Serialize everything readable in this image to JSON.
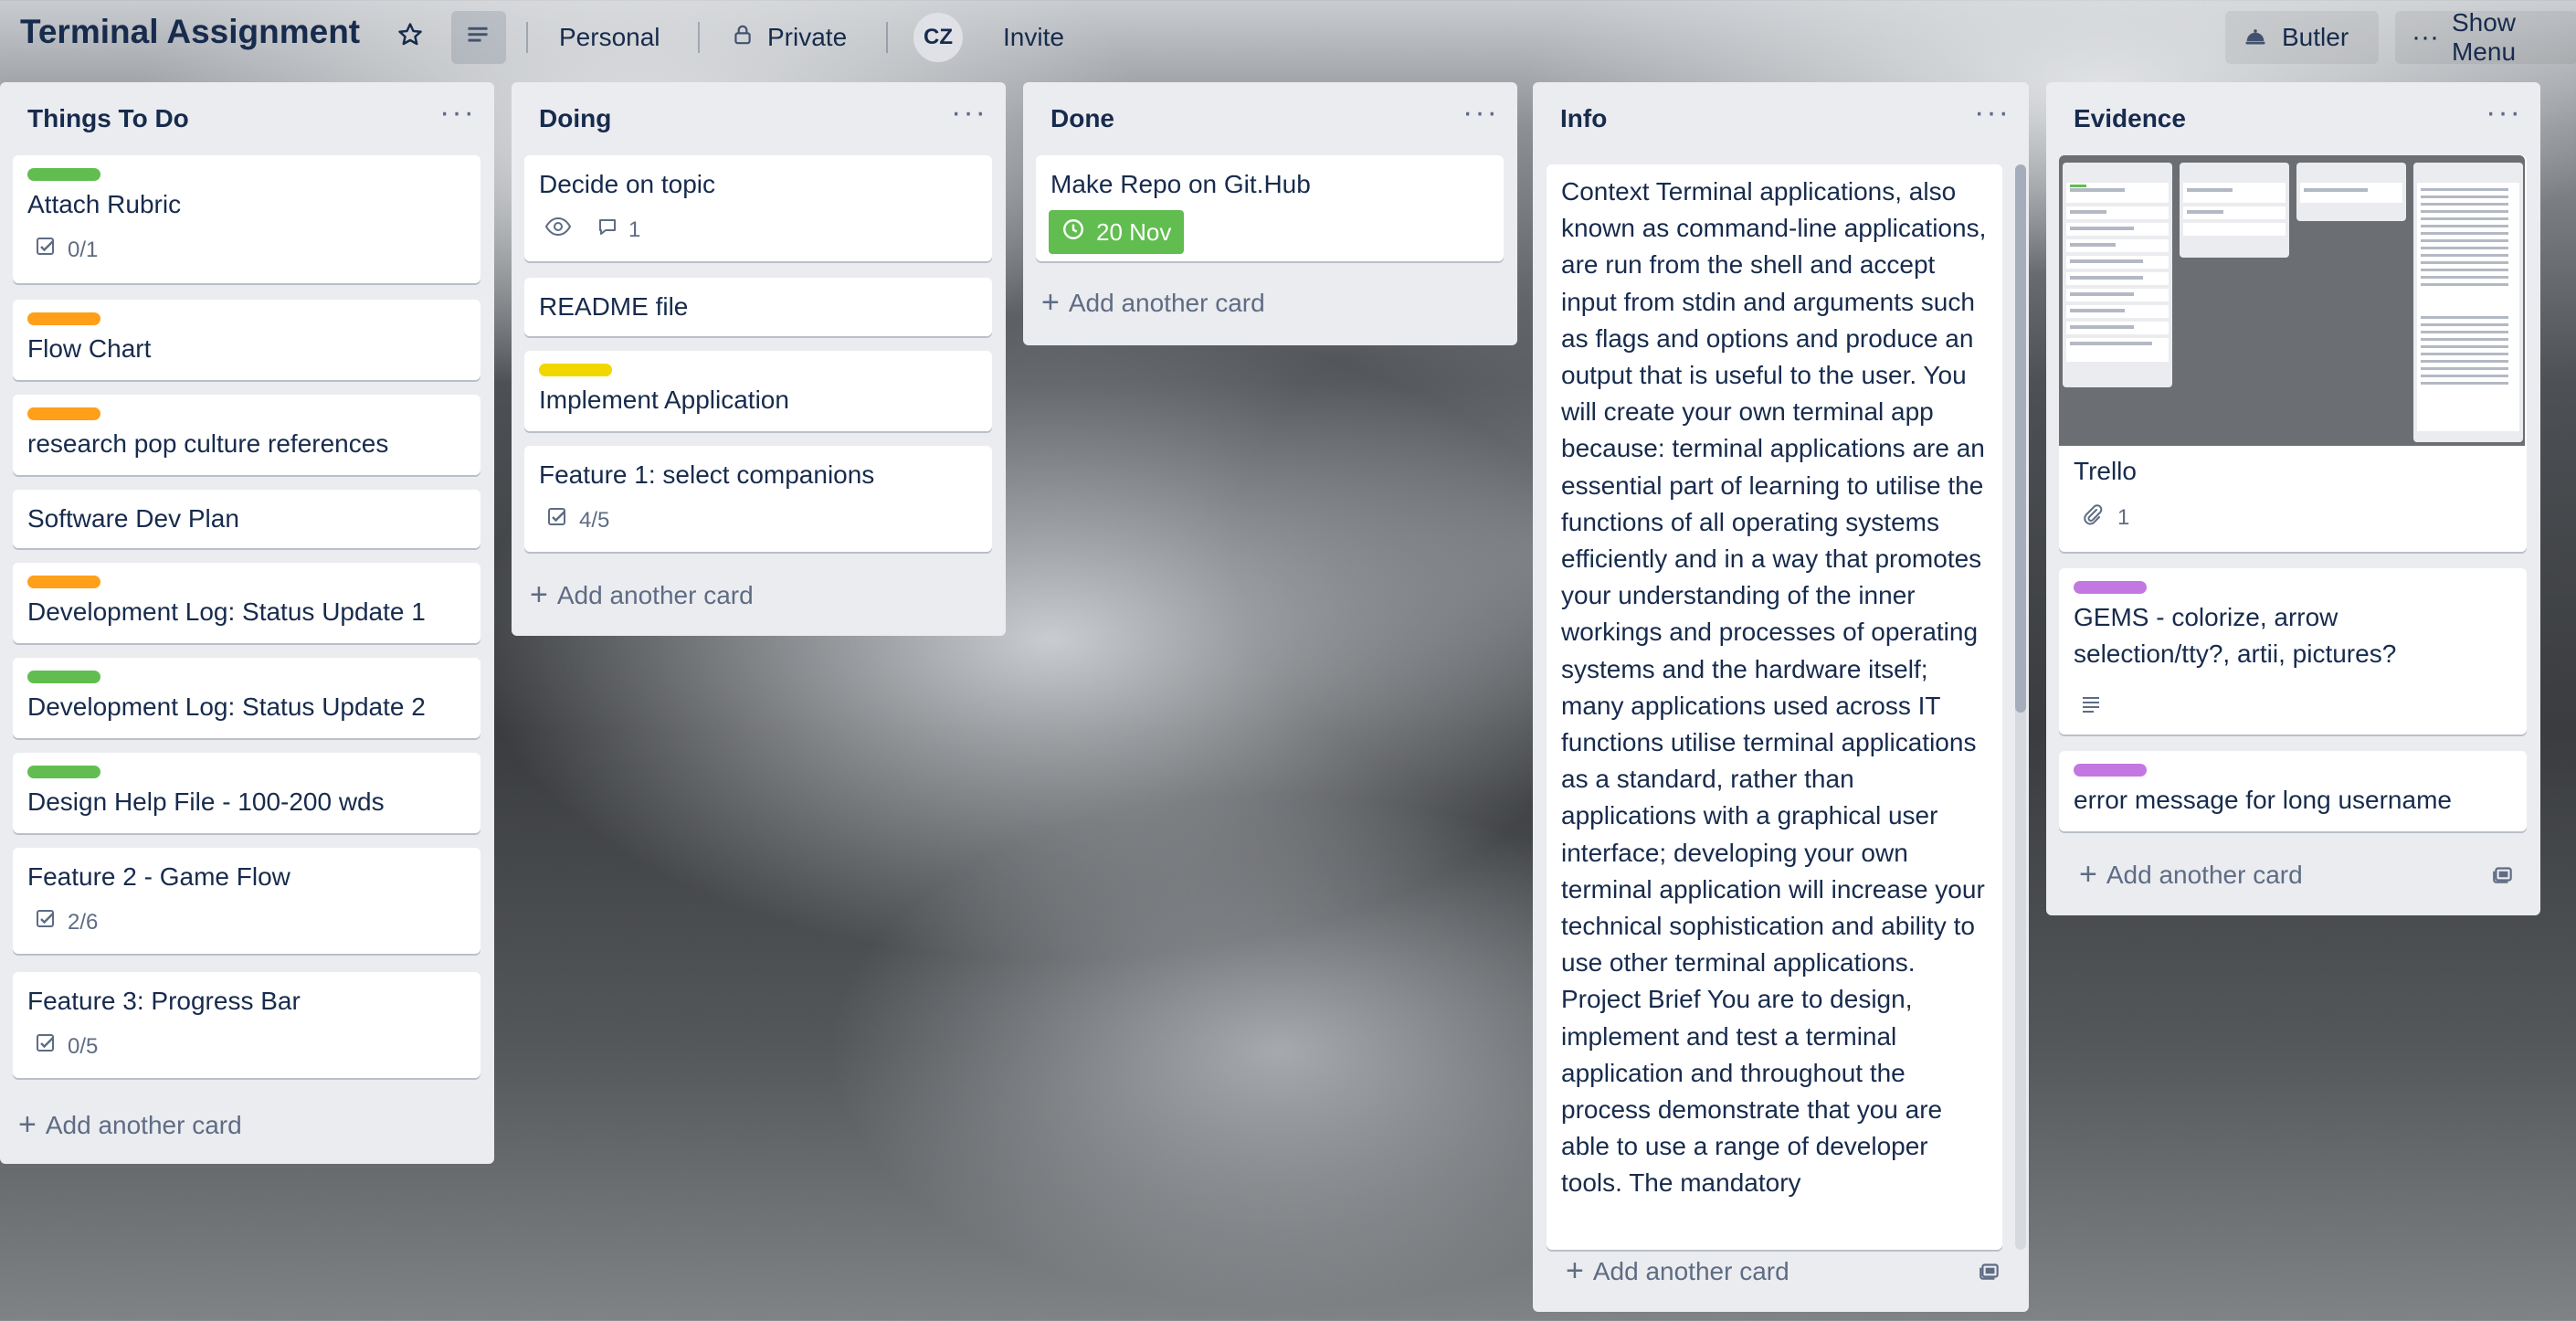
{
  "header": {
    "board_title": "Terminal Assignment",
    "personal": "Personal",
    "private": "Private",
    "avatar": "CZ",
    "invite": "Invite",
    "butler": "Butler",
    "show_menu": "Show Menu"
  },
  "colors": {
    "green": "#61bd4f",
    "orange": "#ff9f1a",
    "yellow": "#f2d600",
    "purple": "#c377e0",
    "due_complete": "#61bd4f"
  },
  "lists": [
    {
      "title": "Things To Do",
      "cards": [
        {
          "text": "Attach Rubric",
          "label": "green",
          "checklist": "0/1"
        },
        {
          "text": "Flow Chart",
          "label": "orange"
        },
        {
          "text": "research pop culture references",
          "label": "orange"
        },
        {
          "text": "Software Dev Plan"
        },
        {
          "text": "Development Log: Status Update 1",
          "label": "orange"
        },
        {
          "text": "Development Log: Status Update 2",
          "label": "green"
        },
        {
          "text": "Design Help File - 100-200 wds",
          "label": "green"
        },
        {
          "text": "Feature 2 - Game Flow",
          "checklist": "2/6"
        },
        {
          "text": "Feature 3: Progress Bar",
          "checklist": "0/5"
        }
      ],
      "add_card": "Add another card"
    },
    {
      "title": "Doing",
      "cards": [
        {
          "text": "Decide on topic",
          "comments": "1"
        },
        {
          "text": "README file"
        },
        {
          "text": "Implement Application",
          "label": "yellow"
        },
        {
          "text": "Feature 1: select companions",
          "checklist": "4/5"
        }
      ],
      "add_card": "Add another card"
    },
    {
      "title": "Done",
      "cards": [
        {
          "text": "Make Repo on Git.Hub",
          "due": "20 Nov"
        }
      ],
      "add_card": "Add another card"
    },
    {
      "title": "Info",
      "cards": [
        {
          "text": "Context Terminal applications, also known as command-line applications, are run from the shell and accept input from stdin and arguments such as flags and options and produce an output that is useful to the user. You will create your own terminal app because: terminal applications are an essential part of learning to utilise the functions of all operating systems efficiently and in a way that promotes your understanding of the inner workings and processes of operating systems and the hardware itself; many applications used across IT functions utilise terminal applications as a standard, rather than applications with a graphical user interface; developing your own terminal application will increase your technical sophistication and ability to use other terminal applications. Project Brief You are to design, implement and test a terminal application and throughout the process demonstrate that you are able to use a range of developer tools. The mandatory"
        }
      ],
      "add_card": "Add another card"
    },
    {
      "title": "Evidence",
      "cards": [
        {
          "text": "Trello",
          "attachments": "1"
        },
        {
          "text": "GEMS - colorize, arrow selection/tty?, artii, pictures?",
          "label": "purple"
        },
        {
          "text": "error message for long username",
          "label": "purple"
        }
      ],
      "add_card": "Add another card"
    }
  ]
}
